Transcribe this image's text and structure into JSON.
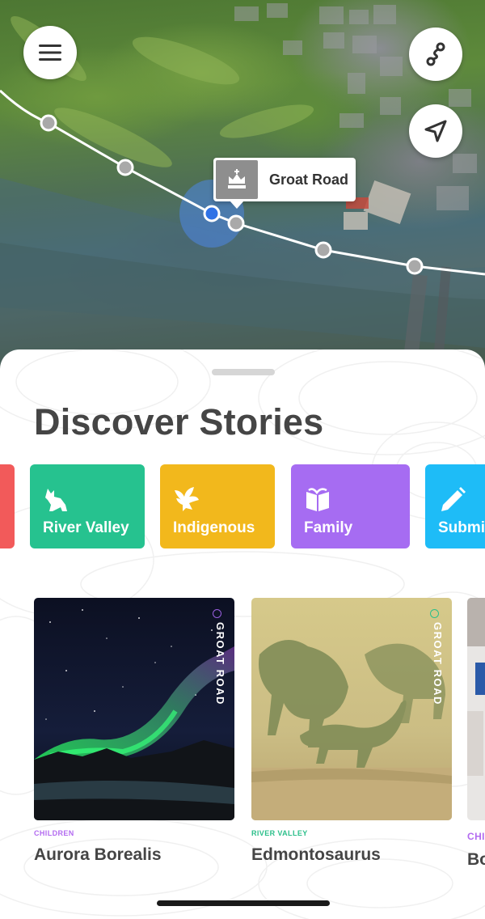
{
  "map": {
    "poi": {
      "label": "Groat Road",
      "icon": "crown-landmark-icon"
    },
    "buttons": {
      "menu": "hamburger-menu-icon",
      "route": "route-icon",
      "locate": "navigation-arrow-icon"
    }
  },
  "sheet": {
    "title": "Discover Stories",
    "categories": [
      {
        "label": "",
        "color": "#f25a5a",
        "icon": ""
      },
      {
        "label": "River Valley",
        "color": "#26c28f",
        "icon": "coyote-icon"
      },
      {
        "label": "Indigenous",
        "color": "#f2b81c",
        "icon": "eagle-icon"
      },
      {
        "label": "Family",
        "color": "#a66cf2",
        "icon": "book-icon"
      },
      {
        "label": "Submit",
        "color": "#1ebcf7",
        "icon": "pencil-icon"
      }
    ],
    "stories": [
      {
        "category": "CHILDREN",
        "category_color": "#b36bf0",
        "title": "Aurora Borealis",
        "location": "GROAT ROAD",
        "dot_color": "#9a5fe0"
      },
      {
        "category": "RIVER VALLEY",
        "category_color": "#2bbf8a",
        "title": "Edmontosaurus",
        "location": "GROAT ROAD",
        "dot_color": "#2bbf8a"
      },
      {
        "category": "CHI",
        "category_color": "#b36bf0",
        "title": "Bo",
        "location": "",
        "dot_color": ""
      }
    ]
  }
}
